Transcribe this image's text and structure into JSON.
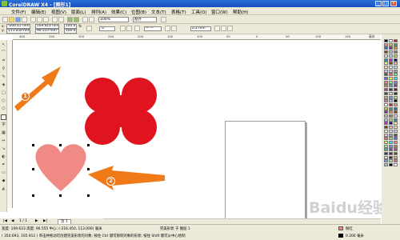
{
  "window": {
    "title": "CorelDRAW X4 - [图形1]",
    "min": "_",
    "max": "□",
    "close": "×"
  },
  "menu": [
    "文件(F)",
    "编辑(E)",
    "视图(V)",
    "版面(L)",
    "排列(A)",
    "效果(C)",
    "位图(B)",
    "文本(T)",
    "表格(T)",
    "工具(O)",
    "窗口(W)",
    "帮助(H)"
  ],
  "toolbar": {
    "zoom": "100%",
    "snap": "贴齐"
  },
  "propbar": {
    "x": "-266.45 mm",
    "y": "115.050 mm",
    "w": "109.623 mm",
    "h": "96.555 mm",
    "scale_w": "100.0",
    "scale_h": "100.0",
    "unit": "%",
    "angle": ".0",
    "outline_width": "0.2 mm"
  },
  "ruler": {
    "ticks": [
      "400",
      "350",
      "300",
      "250",
      "200",
      "150",
      "100",
      "50",
      "0",
      "50",
      "100",
      "150"
    ],
    "unit": "毫米"
  },
  "annotations": {
    "badge1": "1",
    "badge2": "2"
  },
  "colors": {
    "red_shape": "#e0141e",
    "heart": "#f08a85",
    "arrow": "#f07a18"
  },
  "pages": {
    "counter": "1 / 1",
    "tab": "页 1"
  },
  "status": {
    "line1": "宽度: 109.623  高度: 96.555  中心: (-216.450, 113.000)  毫米",
    "line1_right": "完美形状 于 图层 1",
    "line2": "( 350.693, 165.912 )    单击并拖动可创建完美形状的对象; 按住 Ctrl 键可限制对象的形状; 按住 Shift 键可从中心绘制",
    "fill_label": "粉红",
    "outline_label": "0.200 毫米"
  },
  "watermark": "Baidu经验"
}
